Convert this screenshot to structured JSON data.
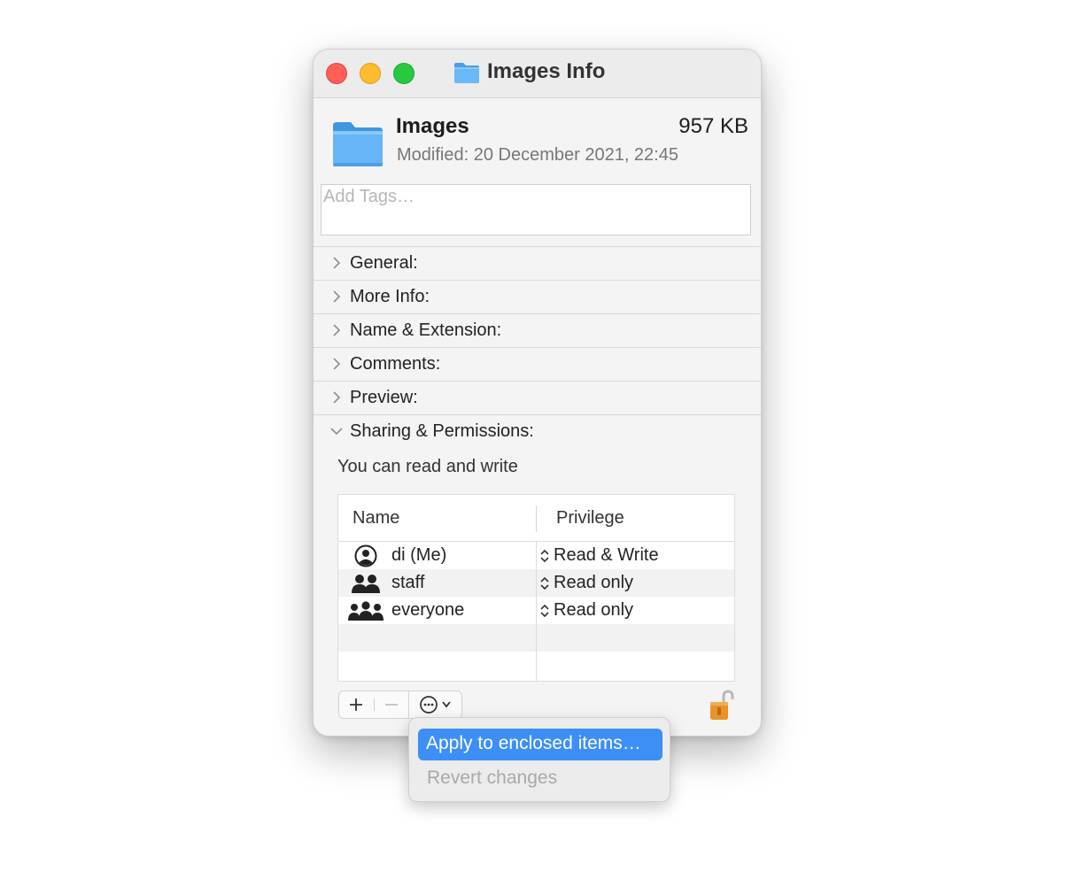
{
  "window": {
    "title": "Images Info"
  },
  "header": {
    "name": "Images",
    "size": "957 KB",
    "modified": "Modified: 20 December 2021, 22:45"
  },
  "tags": {
    "placeholder": "Add Tags…"
  },
  "sections": [
    {
      "label": "General:",
      "expanded": false
    },
    {
      "label": "More Info:",
      "expanded": false
    },
    {
      "label": "Name & Extension:",
      "expanded": false
    },
    {
      "label": "Comments:",
      "expanded": false
    },
    {
      "label": "Preview:",
      "expanded": false
    },
    {
      "label": "Sharing & Permissions:",
      "expanded": true
    }
  ],
  "permissions": {
    "summary": "You can read and write",
    "columns": {
      "name": "Name",
      "privilege": "Privilege"
    },
    "rows": [
      {
        "name": "di (Me)",
        "privilege": "Read & Write",
        "icon": "user-circle-icon"
      },
      {
        "name": "staff",
        "privilege": "Read only",
        "icon": "group-two-icon"
      },
      {
        "name": "everyone",
        "privilege": "Read only",
        "icon": "group-three-icon"
      }
    ]
  },
  "toolbar": {
    "add_icon": "plus-icon",
    "remove_icon": "minus-icon",
    "action_icon": "ellipsis-circle-icon",
    "lock_icon": "unlocked-padlock-icon"
  },
  "menu": {
    "items": [
      {
        "label": "Apply to enclosed items…",
        "state": "highlighted"
      },
      {
        "label": "Revert changes",
        "state": "disabled"
      }
    ]
  },
  "colors": {
    "accent": "#3d8ff6",
    "folder": "#5aaef5",
    "close": "#fe5f57",
    "minimize": "#febc2e",
    "zoom": "#28c840"
  }
}
